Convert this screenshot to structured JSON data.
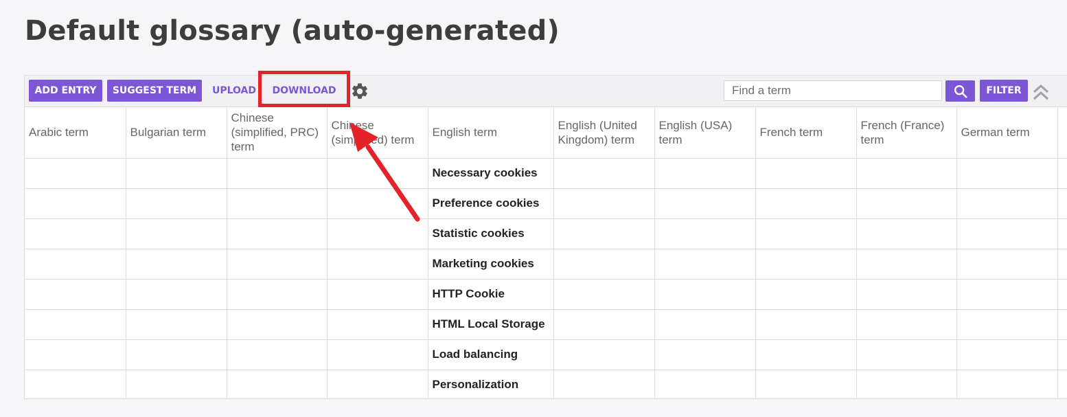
{
  "page_title": "Default glossary (auto-generated)",
  "toolbar": {
    "add_entry": "ADD ENTRY",
    "suggest_term": "SUGGEST TERM",
    "upload": "UPLOAD",
    "download": "DOWNLOAD",
    "search_placeholder": "Find a term",
    "filter": "FILTER"
  },
  "icons": {
    "settings": "gear-icon",
    "search": "search-icon",
    "collapse": "double-chevron-up-icon"
  },
  "colors": {
    "accent": "#7b57d6",
    "annotation": "#e4222a"
  },
  "columns": [
    "Arabic term",
    "Bulgarian term",
    "Chinese (simplified, PRC) term",
    "Chinese (simplified) term",
    "English term",
    "English (United Kingdom) term",
    "English (USA) term",
    "French term",
    "French (France) term",
    "German term"
  ],
  "rows": [
    {
      "english": "Necessary cookies"
    },
    {
      "english": "Preference cookies"
    },
    {
      "english": "Statistic cookies"
    },
    {
      "english": "Marketing cookies"
    },
    {
      "english": "HTTP Cookie"
    },
    {
      "english": "HTML Local Storage"
    },
    {
      "english": "Load balancing"
    },
    {
      "english": "Personalization"
    }
  ]
}
